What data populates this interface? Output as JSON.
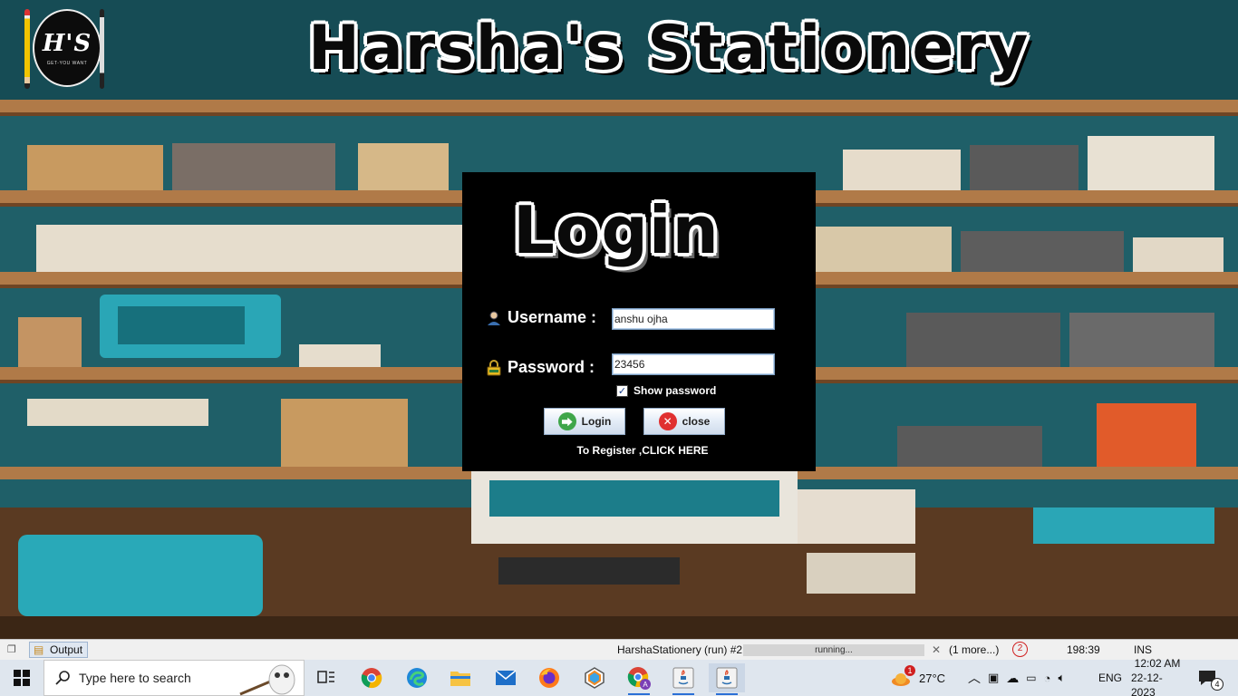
{
  "app": {
    "title": "Harsha's Stationery",
    "logo_text": "H'S",
    "logo_tagline": "GET-YOU WANT"
  },
  "login": {
    "heading": "Login",
    "username_label": "Username :",
    "username_value": "anshu ojha",
    "password_label": "Password :",
    "password_value": "23456",
    "show_password_label": "Show password",
    "show_password_checked": true,
    "login_button": "Login",
    "close_button": "close",
    "register_link": "To Register ,CLICK HERE"
  },
  "ide_status": {
    "output_tab": "Output",
    "run_task": "HarshaStationery (run) #2",
    "progress_text": "running...",
    "more_tasks": "(1 more...)",
    "notification_count": "2",
    "cursor_position": "198:39",
    "insert_mode": "INS"
  },
  "taskbar": {
    "search_placeholder": "Type here to search",
    "weather_temp": "27°C",
    "weather_badge": "1",
    "language": "ENG",
    "time": "12:02 AM",
    "date": "22-12-2023",
    "notifications_count": "4",
    "apps": [
      "task-view",
      "chrome",
      "edge",
      "file-explorer",
      "mail",
      "firefox",
      "app-hex",
      "chrome-profile",
      "java",
      "java-active"
    ]
  },
  "colors": {
    "panel_bg": "#000000",
    "taskbar_bg": "#dfe6ee",
    "accent": "#2a6fd6"
  }
}
